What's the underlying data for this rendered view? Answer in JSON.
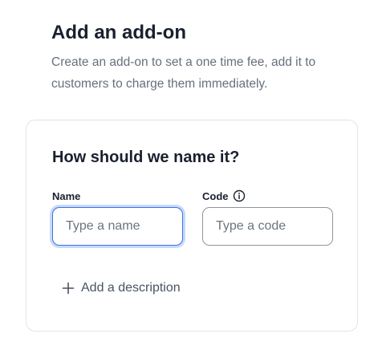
{
  "header": {
    "title": "Add an add-on",
    "subtitle": "Create an add-on to set a one time fee, add it to customers to charge them immediately."
  },
  "card": {
    "title": "How should we name it?",
    "name_field": {
      "label": "Name",
      "placeholder": "Type a name",
      "value": ""
    },
    "code_field": {
      "label": "Code",
      "placeholder": "Type a code",
      "value": "",
      "icon": "info-icon"
    },
    "add_description": {
      "label": "Add a description",
      "icon": "plus-icon"
    }
  },
  "colors": {
    "focus_border": "#3b73e0",
    "focus_ring": "#c7dafb",
    "text_primary": "#19212e",
    "text_secondary": "#66707d",
    "card_border": "#e1e4e9"
  }
}
